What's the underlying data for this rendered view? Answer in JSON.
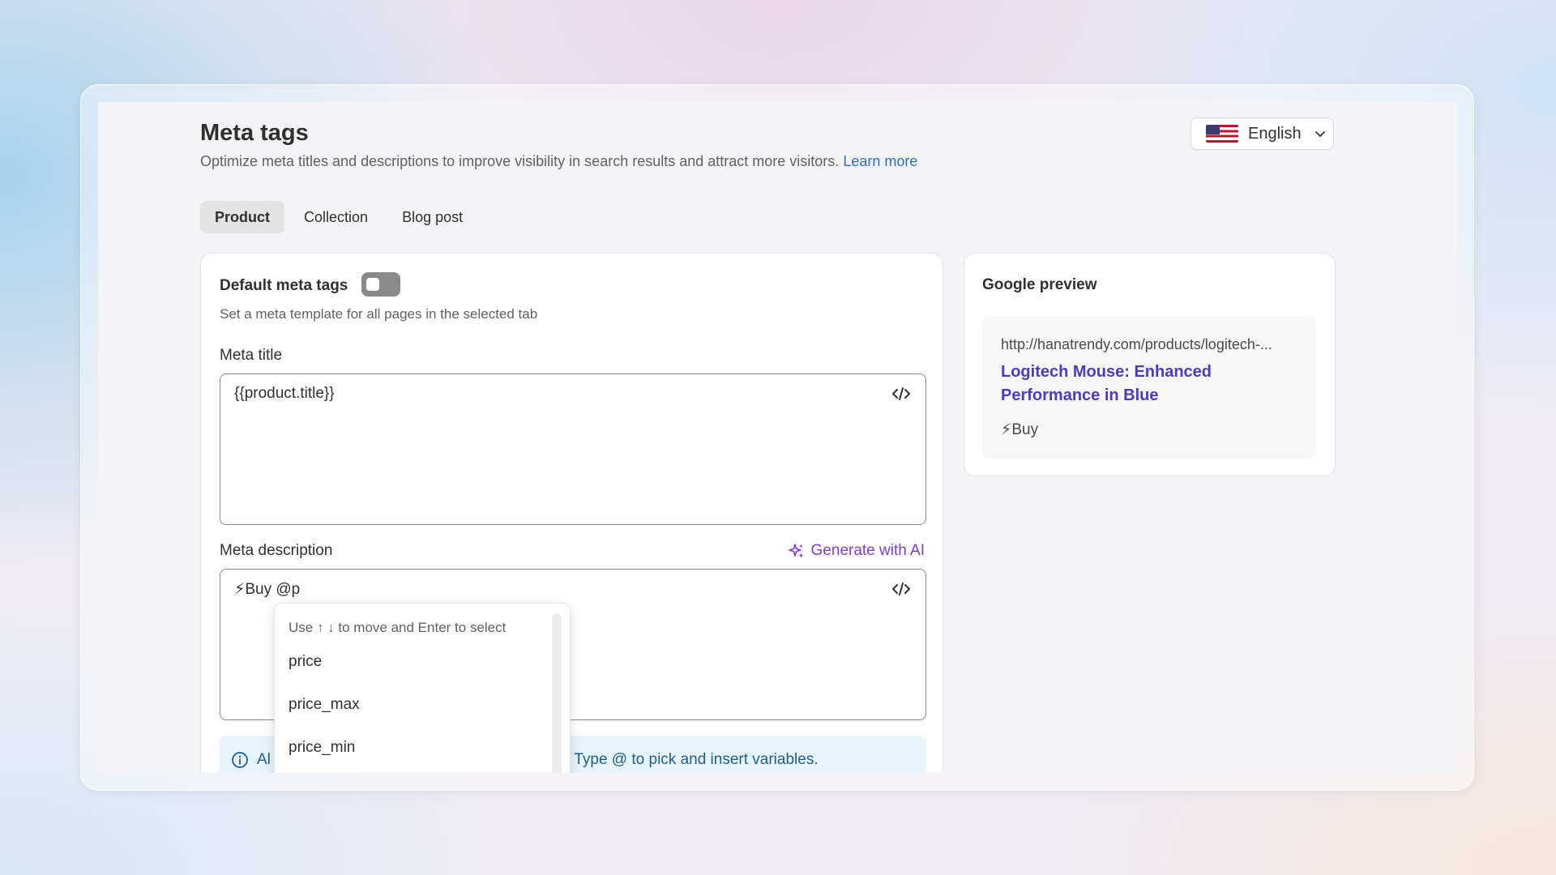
{
  "header": {
    "title": "Meta tags",
    "subtitle": "Optimize meta titles and descriptions to improve visibility in search results and attract more visitors.",
    "learn_more": "Learn more"
  },
  "language": {
    "label": "English",
    "flag_icon": "us-flag-icon"
  },
  "tabs": [
    {
      "label": "Product",
      "active": true
    },
    {
      "label": "Collection",
      "active": false
    },
    {
      "label": "Blog post",
      "active": false
    }
  ],
  "default_meta": {
    "title": "Default meta tags",
    "subtitle": "Set a meta template for all pages in the selected tab",
    "toggle_on": false
  },
  "meta_title": {
    "label": "Meta title",
    "value": "{{product.title}}"
  },
  "meta_description": {
    "label": "Meta description",
    "value": "⚡Buy @p",
    "generate_ai": "Generate with AI"
  },
  "autocomplete": {
    "hint": "Use ↑ ↓ to move and Enter to select",
    "options": [
      "price",
      "price_max",
      "price_min"
    ]
  },
  "info_banner": {
    "text_start": "Al",
    "text_end": "l. Type @ to pick and insert variables."
  },
  "google_preview": {
    "title": "Google preview",
    "url": "http://hanatrendy.com/products/logitech-...",
    "link_title": "Logitech Mouse: Enhanced Performance in Blue",
    "description": "⚡Buy"
  },
  "colors": {
    "link_blue": "#2c6ecb",
    "ai_purple": "#7e3bd9",
    "preview_link": "#4b3bc2",
    "banner_bg": "#e8f4fb"
  }
}
